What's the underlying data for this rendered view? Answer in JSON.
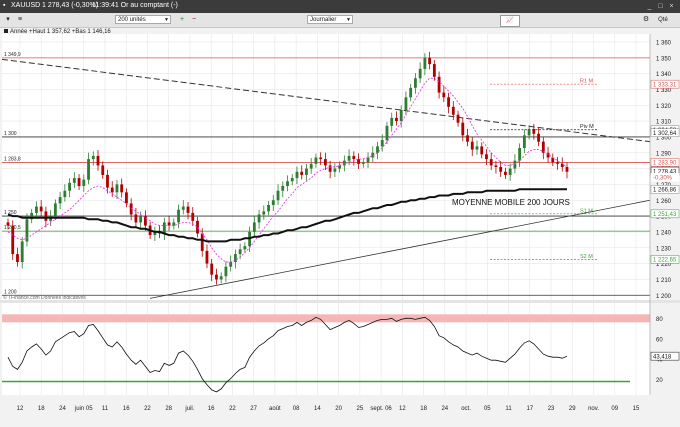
{
  "window": {
    "symbol": "XAUUSD",
    "change": "1 278,43 (-0,30%)",
    "status": "11:39:41 Or au comptant (-)",
    "units": "200 unités",
    "period": "Journalier",
    "qte_label": "Qté"
  },
  "legend": "Année +Haut 1 357,62 +Bas 1 146,16",
  "source_note": "© TFinance.com Données indicatives",
  "annotation": "MOYENNE MOBILE 200 JOURS",
  "colors": {
    "up": "#2e7d32",
    "down": "#b00000",
    "ma_short": "#e83ee8",
    "ma_long": "#111111",
    "resistance": "#d9534f",
    "support": "#3aa23a",
    "grid": "#e6e6e6"
  },
  "chart_data": {
    "type": "line",
    "price_axis": {
      "ylim": [
        1197,
        1365
      ],
      "ticks": [
        "1 360",
        "1 350",
        "1 340",
        "1 330",
        "1 320",
        "1 310",
        "1 300",
        "1 290",
        "1 280",
        "1 270",
        "1 260",
        "1 250",
        "1 240",
        "1 230",
        "1 220",
        "1 210",
        "1 200"
      ]
    },
    "x_ticks": [
      "12",
      "18",
      "24",
      "juin 05",
      "11",
      "16",
      "22",
      "28",
      "juil.",
      "16",
      "22",
      "27",
      "août",
      "08",
      "14",
      "20",
      "25",
      "sept. 06",
      "12",
      "18",
      "24",
      "oct.",
      "05",
      "11",
      "17",
      "23",
      "29",
      "nov.",
      "09",
      "15"
    ],
    "left_labels": [
      {
        "text": "1 349,9",
        "y": 1349.9
      },
      {
        "text": "1 300",
        "y": 1300
      },
      {
        "text": "1 283,8",
        "y": 1283.8
      },
      {
        "text": "1 250",
        "y": 1250
      },
      {
        "text": "1 240,5",
        "y": 1240.5
      },
      {
        "text": "1 200",
        "y": 1200
      }
    ],
    "right_labels": [
      {
        "text": "1 333,31",
        "y": 1333.31,
        "kind": "resistance"
      },
      {
        "text": "1 304,53",
        "y": 1304.53,
        "kind": "plain"
      },
      {
        "text": "1 302,64",
        "y": 1302.64,
        "kind": "plain"
      },
      {
        "text": "1 283,90",
        "y": 1283.9,
        "kind": "resistance"
      },
      {
        "text": "1 278,43",
        "y": 1278.43,
        "kind": "price"
      },
      {
        "text": "-0,30%",
        "y": 1274.5,
        "kind": "change"
      },
      {
        "text": "1 266,86",
        "y": 1266.86,
        "kind": "plain"
      },
      {
        "text": "1 251,43",
        "y": 1251.43,
        "kind": "support"
      },
      {
        "text": "1 222,65",
        "y": 1222.65,
        "kind": "support"
      }
    ],
    "levels": [
      {
        "name": "R1 M",
        "y": 1333.31,
        "kind": "resistance",
        "label": "R1 M"
      },
      {
        "name": "Piv M",
        "y": 1304.53,
        "kind": "pivot",
        "label": "Piv M"
      },
      {
        "name": "S1 M",
        "y": 1251.43,
        "kind": "support",
        "label": "S1 M"
      },
      {
        "name": "S2 M",
        "y": 1222.65,
        "kind": "support",
        "label": "S2 M"
      }
    ],
    "close": [
      1244,
      1226,
      1221,
      1234,
      1248,
      1252,
      1256,
      1253,
      1247,
      1250,
      1258,
      1262,
      1266,
      1271,
      1274,
      1269,
      1273,
      1286,
      1288,
      1282,
      1276,
      1268,
      1265,
      1270,
      1265,
      1258,
      1251,
      1246,
      1250,
      1244,
      1238,
      1240,
      1239,
      1246,
      1244,
      1246,
      1254,
      1256,
      1252,
      1247,
      1239,
      1228,
      1220,
      1213,
      1210,
      1212,
      1218,
      1221,
      1226,
      1229,
      1231,
      1240,
      1246,
      1251,
      1253,
      1257,
      1260,
      1266,
      1269,
      1272,
      1274,
      1278,
      1276,
      1280,
      1283,
      1287,
      1286,
      1282,
      1278,
      1280,
      1282,
      1285,
      1288,
      1286,
      1283,
      1284,
      1287,
      1290,
      1294,
      1298,
      1307,
      1312,
      1310,
      1317,
      1325,
      1331,
      1337,
      1343,
      1350,
      1346,
      1338,
      1328,
      1325,
      1319,
      1314,
      1309,
      1301,
      1297,
      1292,
      1294,
      1289,
      1286,
      1282,
      1281,
      1278,
      1276,
      1280,
      1285,
      1293,
      1301,
      1305,
      1302,
      1297,
      1290,
      1287,
      1284,
      1283,
      1281,
      1278
    ],
    "ma_short": [
      1240,
      1238,
      1236,
      1235,
      1236,
      1238,
      1240,
      1242,
      1244,
      1246,
      1248,
      1250,
      1252,
      1254,
      1257,
      1260,
      1263,
      1266,
      1268,
      1269,
      1268,
      1266,
      1264,
      1262,
      1260,
      1258,
      1255,
      1253,
      1251,
      1249,
      1247,
      1245,
      1244,
      1244,
      1244,
      1244,
      1245,
      1246,
      1246,
      1245,
      1243,
      1239,
      1235,
      1230,
      1226,
      1223,
      1221,
      1221,
      1222,
      1224,
      1227,
      1230,
      1234,
      1238,
      1242,
      1246,
      1250,
      1253,
      1257,
      1261,
      1264,
      1268,
      1270,
      1272,
      1274,
      1277,
      1279,
      1280,
      1281,
      1281,
      1282,
      1283,
      1284,
      1285,
      1286,
      1286,
      1287,
      1288,
      1290,
      1293,
      1297,
      1301,
      1305,
      1309,
      1314,
      1319,
      1324,
      1329,
      1334,
      1337,
      1337,
      1335,
      1332,
      1329,
      1326,
      1322,
      1318,
      1313,
      1307,
      1302,
      1298,
      1294,
      1290,
      1287,
      1284,
      1282,
      1282,
      1283,
      1285,
      1288,
      1291,
      1292,
      1292,
      1291,
      1289,
      1287,
      1285,
      1283,
      1281
    ],
    "ma_long": [
      1251,
      1250,
      1250,
      1249,
      1249,
      1249,
      1249,
      1249,
      1249,
      1249,
      1249,
      1249,
      1249,
      1249,
      1249,
      1249,
      1249,
      1248,
      1248,
      1248,
      1247,
      1247,
      1246,
      1246,
      1245,
      1244,
      1243,
      1243,
      1242,
      1242,
      1241,
      1240,
      1240,
      1239,
      1238,
      1238,
      1237,
      1237,
      1236,
      1236,
      1235,
      1235,
      1234,
      1234,
      1234,
      1234,
      1234,
      1235,
      1235,
      1235,
      1236,
      1236,
      1237,
      1237,
      1238,
      1238,
      1239,
      1239,
      1240,
      1241,
      1241,
      1242,
      1243,
      1243,
      1244,
      1245,
      1246,
      1247,
      1247,
      1248,
      1249,
      1250,
      1251,
      1252,
      1252,
      1253,
      1254,
      1255,
      1255,
      1256,
      1257,
      1257,
      1258,
      1259,
      1259,
      1260,
      1260,
      1261,
      1261,
      1262,
      1262,
      1263,
      1263,
      1263,
      1264,
      1264,
      1264,
      1265,
      1265,
      1265,
      1265,
      1266,
      1266,
      1266,
      1266,
      1266,
      1266,
      1266,
      1267,
      1267,
      1267,
      1267,
      1267,
      1267,
      1267,
      1267,
      1267,
      1267,
      1267
    ],
    "osc_axis": {
      "ylim": [
        5,
        95
      ],
      "ticks": [
        "80",
        "60",
        "40",
        "20"
      ]
    },
    "osc_value_label": "43,418",
    "osc_bands": [
      {
        "y": 80,
        "kind": "overbought"
      },
      {
        "y": 30,
        "kind": "oversold"
      }
    ],
    "oscillator": [
      42,
      33,
      30,
      37,
      48,
      52,
      55,
      50,
      44,
      48,
      57,
      60,
      63,
      66,
      67,
      62,
      65,
      73,
      74,
      68,
      61,
      54,
      52,
      57,
      52,
      45,
      39,
      35,
      39,
      33,
      27,
      29,
      28,
      36,
      34,
      36,
      46,
      48,
      44,
      38,
      30,
      21,
      15,
      10,
      8,
      11,
      17,
      21,
      26,
      30,
      32,
      42,
      48,
      53,
      56,
      60,
      63,
      68,
      70,
      72,
      73,
      76,
      73,
      76,
      78,
      81,
      79,
      74,
      69,
      71,
      73,
      76,
      78,
      75,
      71,
      72,
      74,
      76,
      78,
      79,
      79,
      80,
      77,
      79,
      80,
      80,
      79,
      80,
      81,
      78,
      72,
      63,
      61,
      57,
      54,
      52,
      48,
      46,
      44,
      46,
      43,
      41,
      39,
      39,
      38,
      37,
      41,
      45,
      51,
      56,
      58,
      55,
      50,
      45,
      43,
      42,
      42,
      41,
      43
    ]
  }
}
